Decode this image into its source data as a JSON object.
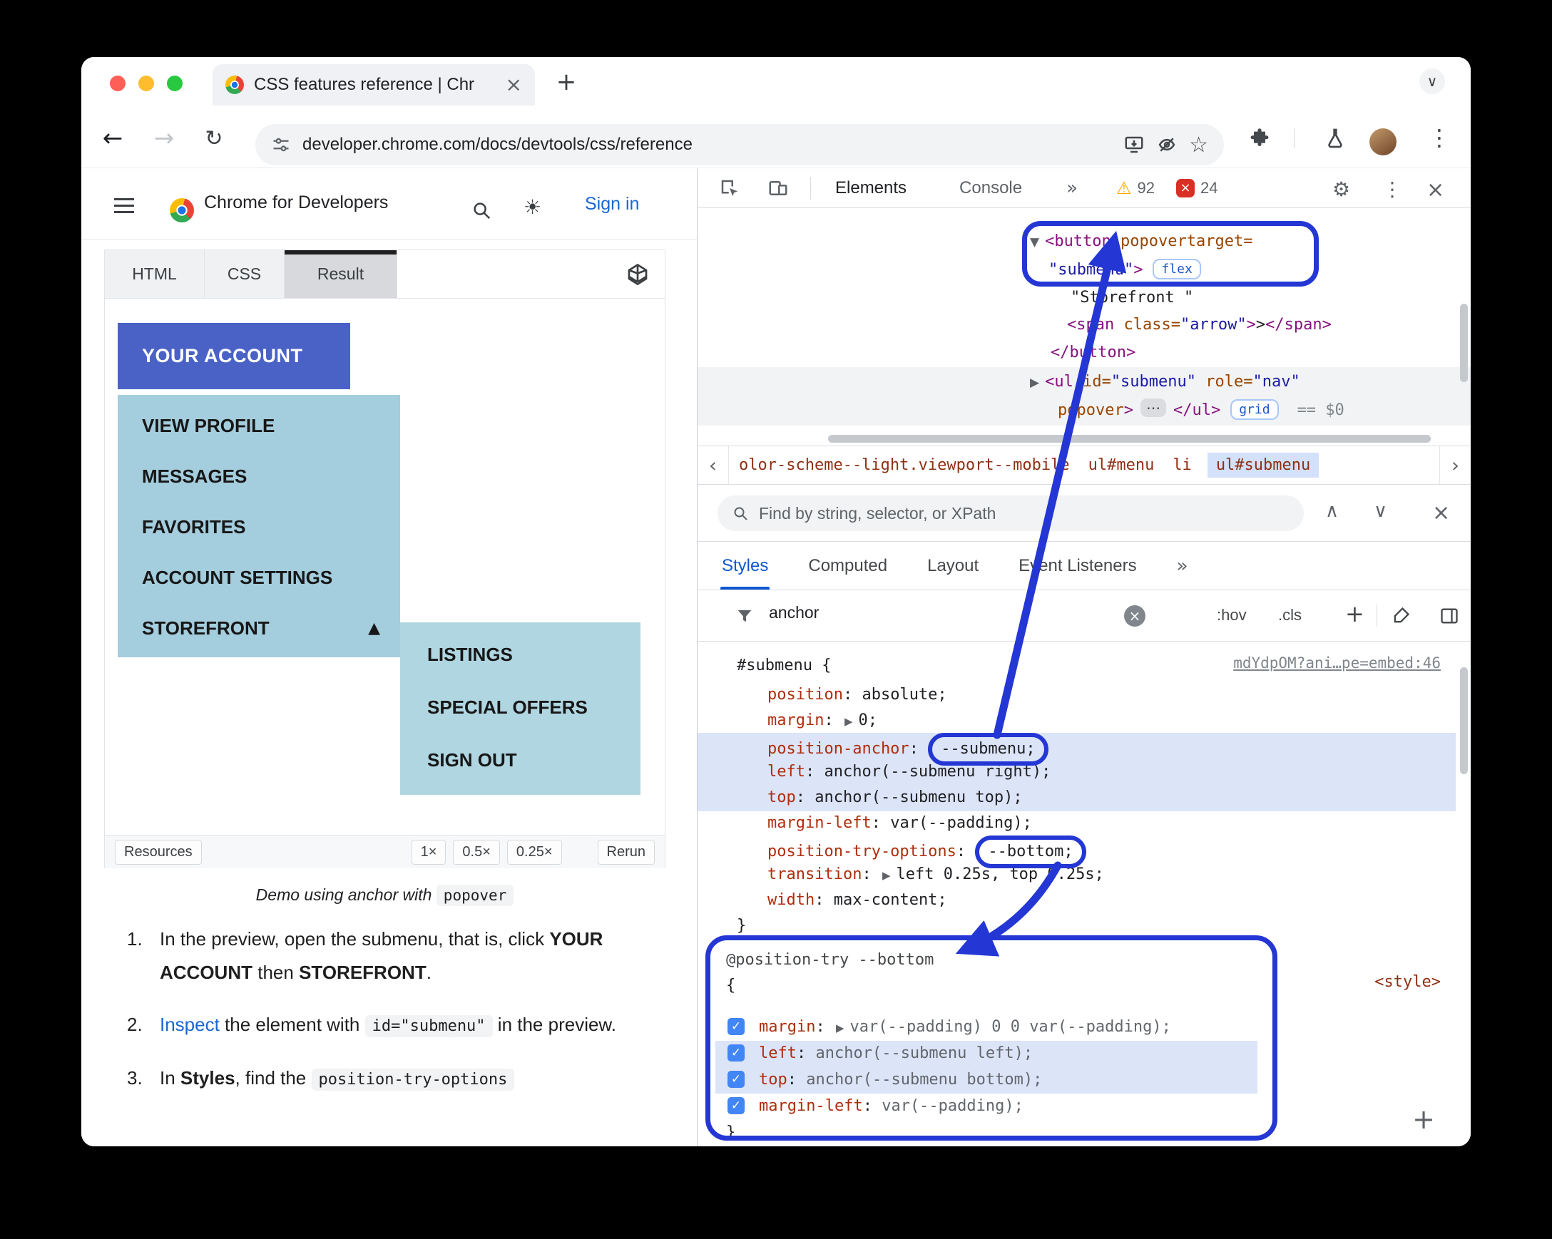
{
  "icons": {
    "close": "×",
    "plus": "+",
    "chevron_down": "∨",
    "chevron_up": "∧",
    "back": "←",
    "forward": "→",
    "reload": "↻",
    "star": "☆",
    "sun": "☀",
    "gear": "⚙",
    "dots": "⋮",
    "more_tabs": "»",
    "warning": "⚠",
    "collapse": "▼",
    "expand": "▶",
    "arrow_up": "▲",
    "ellipsis": "⋯",
    "check": "✓",
    "crumb_left": "‹",
    "crumb_right": "›"
  },
  "window": {
    "tab_title": "CSS features reference  |  Chr",
    "url": "developer.chrome.com/docs/devtools/css/reference"
  },
  "site": {
    "brand": "Chrome for Developers",
    "sign_in": "Sign in"
  },
  "demo": {
    "tabs": [
      "HTML",
      "CSS",
      "Result"
    ],
    "account_button": "YOUR ACCOUNT",
    "menu_items": [
      "VIEW PROFILE",
      "MESSAGES",
      "FAVORITES",
      "ACCOUNT SETTINGS",
      "STOREFRONT"
    ],
    "submenu_items": [
      "LISTINGS",
      "SPECIAL OFFERS",
      "SIGN OUT"
    ],
    "resources": "Resources",
    "zoom_1": "1×",
    "zoom_05": "0.5×",
    "zoom_025": "0.25×",
    "rerun": "Rerun",
    "caption_text": "Demo using anchor with ",
    "caption_code": "popover"
  },
  "steps": {
    "s1_num": "1.",
    "s1_t1": "In the preview, open the submenu, that is, click ",
    "s1_b1": "YOUR ACCOUNT",
    "s1_t2": " then ",
    "s1_b2": "STOREFRONT",
    "s1_t3": ".",
    "s2_num": "2.",
    "s2_link": "Inspect",
    "s2_t1": " the element with ",
    "s2_code": "id=\"submenu\"",
    "s2_t2": " in the preview.",
    "s3_num": "3.",
    "s3_t1": "In ",
    "s3_b1": "Styles",
    "s3_t2": ", find the ",
    "s3_code": "position-try-options"
  },
  "devtools": {
    "tab_elements": "Elements",
    "tab_console": "Console",
    "warning_count": "92",
    "error_count": "24",
    "tree": {
      "btn_open": "<button",
      "btn_attr": " popovertarget=",
      "btn_val": "\"submenu\"",
      "gt": ">",
      "flex_badge": "flex",
      "text_node": "\"Storefront \"",
      "span_open": "<span",
      "span_attr": " class=",
      "span_val": "\"arrow\"",
      "span_text": ">",
      "span_close": "</span>",
      "btn_close": "</button>",
      "ul_open": "<ul",
      "ul_attr_id": " id=",
      "ul_val_id": "\"submenu\"",
      "ul_attr_role": " role=",
      "ul_val_role": "\"nav\"",
      "ul_attr_popover": "popover",
      "ul_gt": ">",
      "ul_close": "</ul>",
      "grid_badge": "grid",
      "eq": "== $0"
    },
    "crumbs": [
      "olor-scheme--light.viewport--mobile",
      "ul#menu",
      "li",
      "ul#submenu"
    ],
    "search_placeholder": "Find by string, selector, or XPath",
    "sidetabs": [
      "Styles",
      "Computed",
      "Layout",
      "Event Listeners"
    ],
    "filter_value": "anchor",
    "hov": ":hov",
    "cls": ".cls",
    "add": "+",
    "punct": {
      "colon": ": ",
      "open": "{",
      "close": "}"
    },
    "rule1": {
      "selector": "#submenu ",
      "source": "mdYdpOM?ani…pe=embed:46",
      "props": [
        {
          "name": "position",
          "value": "absolute;"
        },
        {
          "name": "margin",
          "value": "0;"
        },
        {
          "name": "position-anchor",
          "value": "--submenu;"
        },
        {
          "name": "left",
          "value": "anchor(--submenu right);"
        },
        {
          "name": "top",
          "value": "anchor(--submenu top);"
        },
        {
          "name": "margin-left",
          "value": "var(--padding);"
        },
        {
          "name": "position-try-options",
          "value": "--bottom;"
        },
        {
          "name": "transition",
          "value": "left 0.25s, top 0.25s;"
        },
        {
          "name": "width",
          "value": "max-content;"
        }
      ]
    },
    "rule2": {
      "at_rule": "@position-try --bottom",
      "style_link": "<style>",
      "props": [
        {
          "name": "margin",
          "value": "var(--padding) 0 0 var(--padding);"
        },
        {
          "name": "left",
          "value": "anchor(--submenu left);"
        },
        {
          "name": "top",
          "value": "anchor(--submenu bottom);"
        },
        {
          "name": "margin-left",
          "value": "var(--padding);"
        }
      ]
    },
    "plus": "+"
  }
}
